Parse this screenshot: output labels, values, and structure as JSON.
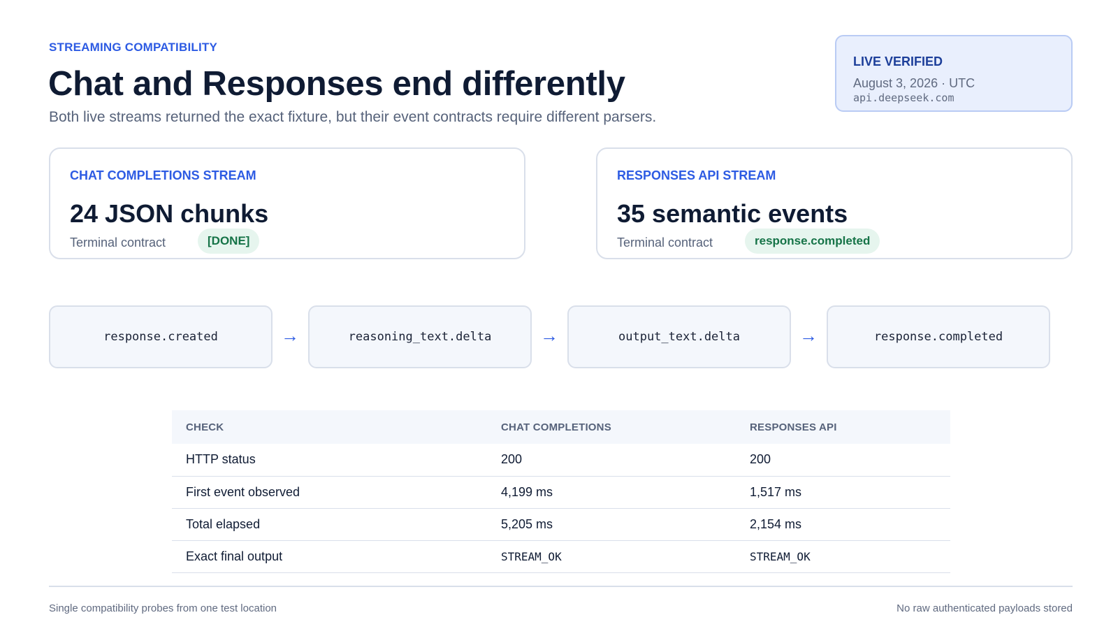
{
  "header": {
    "eyebrow": "STREAMING COMPATIBILITY",
    "title": "Chat and Responses end differently",
    "subtitle": "Both live streams returned the exact fixture, but their event contracts require different parsers."
  },
  "verification": {
    "title": "LIVE VERIFIED",
    "date": "August 3, 2026 · UTC",
    "host": "api.deepseek.com"
  },
  "streams": {
    "chat": {
      "eyebrow": "CHAT COMPLETIONS STREAM",
      "metric": "24 JSON chunks",
      "contract_label": "Terminal contract",
      "contract_value": "[DONE]"
    },
    "responses": {
      "eyebrow": "RESPONSES API STREAM",
      "metric": "35 semantic events",
      "contract_label": "Terminal contract",
      "contract_value": "response.completed"
    }
  },
  "flow": {
    "steps": [
      "response.created",
      "reasoning_text.delta",
      "output_text.delta",
      "response.completed"
    ],
    "arrow": "→"
  },
  "table": {
    "headers": [
      "CHECK",
      "CHAT COMPLETIONS",
      "RESPONSES API"
    ],
    "rows": [
      [
        "HTTP status",
        "200",
        "200"
      ],
      [
        "First event observed",
        "4,199 ms",
        "1,517 ms"
      ],
      [
        "Total elapsed",
        "5,205 ms",
        "2,154 ms"
      ],
      [
        "Exact final output",
        "STREAM_OK",
        "STREAM_OK"
      ]
    ]
  },
  "footer": {
    "left": "Single compatibility probes from one test location",
    "right": "No raw authenticated payloads stored"
  },
  "colors": {
    "accent": "#2d5be3",
    "heading": "#0f1b33",
    "success_bg": "#e6f5ee",
    "success_text": "#157347",
    "verify_bg": "#e9effd"
  }
}
